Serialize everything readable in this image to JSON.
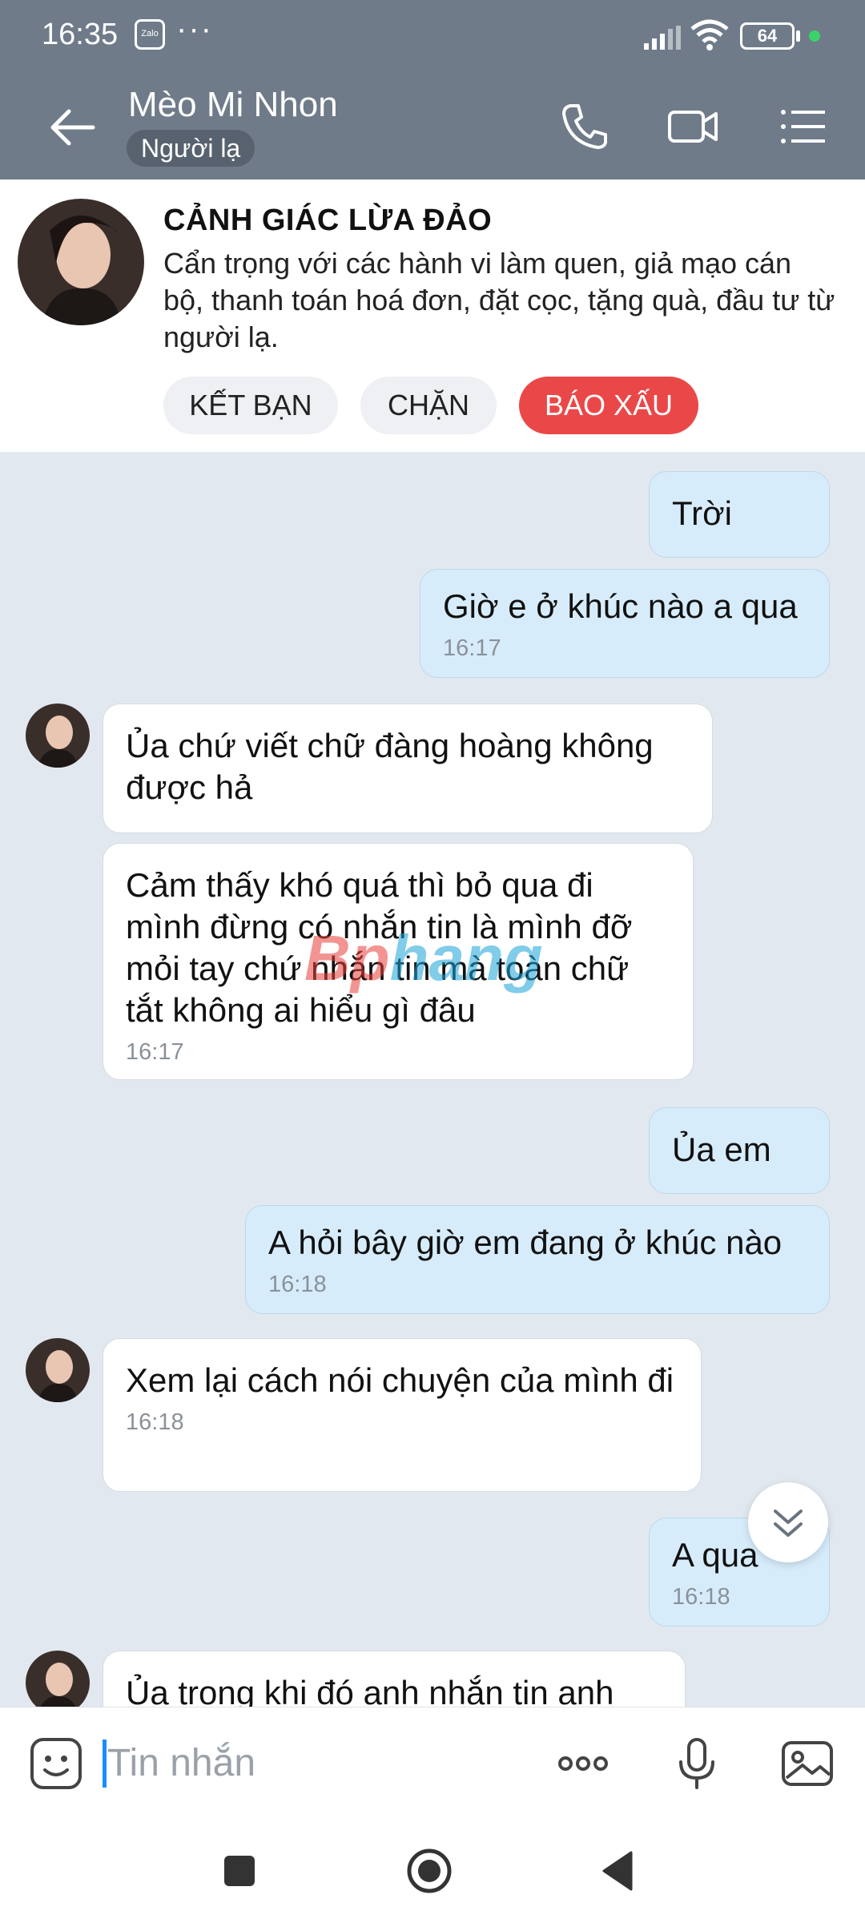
{
  "status": {
    "time": "16:35",
    "app_icon_label": "Zalo",
    "dots": "···",
    "battery": "64"
  },
  "header": {
    "name": "Mèo Mi Nhon",
    "badge": "Người lạ"
  },
  "warning": {
    "title": "CẢNH GIÁC LỪA ĐẢO",
    "text": "Cẩn trọng với các hành vi làm quen, giả mạo cán bộ, thanh toán hoá đơn, đặt cọc, tặng quà, đầu tư từ người lạ.",
    "buttons": {
      "add_friend": "KẾT BẠN",
      "block": "CHẶN",
      "report": "BÁO XẤU"
    }
  },
  "messages": [
    {
      "dir": "out",
      "text": "Trời",
      "time": ""
    },
    {
      "dir": "out",
      "text": "Giờ e ở khúc nào a qua",
      "time": "16:17"
    },
    {
      "dir": "in",
      "text": "Ủa chứ viết chữ đàng hoàng không được hả",
      "time": ""
    },
    {
      "dir": "in",
      "text": "Cảm thấy khó quá thì bỏ qua đi mình đừng có nhắn tin là mình đỡ mỏi tay chứ nhắn tin mà toàn chữ tắt không ai hiểu gì đâu",
      "time": "16:17"
    },
    {
      "dir": "out",
      "text": "Ủa em",
      "time": ""
    },
    {
      "dir": "out",
      "text": "A hỏi bây giờ em đang ở khúc nào",
      "time": "16:18"
    },
    {
      "dir": "in",
      "text": "Xem lại cách nói chuyện của mình đi",
      "time": "16:18"
    },
    {
      "dir": "out",
      "text": "A qua",
      "time": "16:18"
    },
    {
      "dir": "in",
      "text": "Ủa trong khi đó anh nhắn tin anh",
      "time": ""
    }
  ],
  "watermark": {
    "part1": "Bp",
    "part2": "hang"
  },
  "input": {
    "placeholder": "Tin nhắn"
  },
  "colors": {
    "header": "#6f7b89",
    "out_bubble": "#d7ecfb",
    "report": "#ea4848",
    "chat_bg": "#e2e8ef"
  }
}
